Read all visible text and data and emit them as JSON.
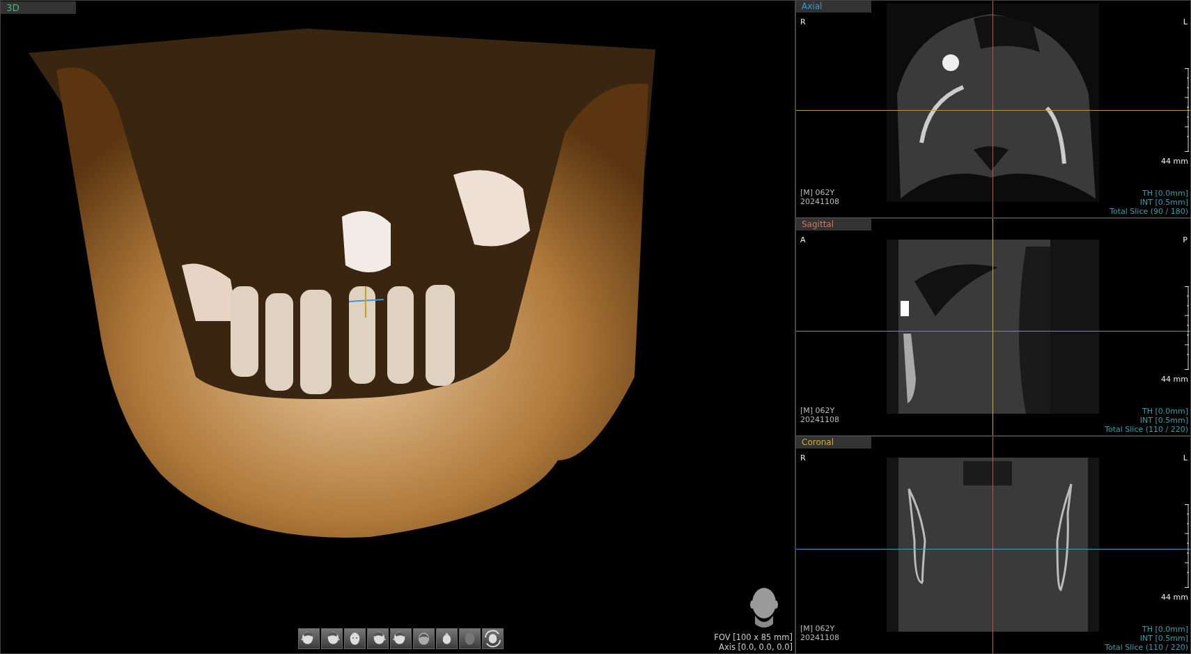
{
  "view_3d": {
    "title": "3D",
    "color": "#3fae7a",
    "fov": "FOV [100 x 85 mm]",
    "axis": "Axis [0.0, 0.0, 0.0]",
    "toolbar": [
      {
        "kind": "left"
      },
      {
        "kind": "right"
      },
      {
        "kind": "front"
      },
      {
        "kind": "right"
      },
      {
        "kind": "left"
      },
      {
        "kind": "back"
      },
      {
        "kind": "top"
      },
      {
        "kind": "blank"
      },
      {
        "kind": "rotate"
      }
    ]
  },
  "slices": [
    {
      "kind": "axial",
      "title": "Axial",
      "color": "#3a9ad9",
      "orient_left": "R",
      "orient_right": "L",
      "scale": "44 mm",
      "patient": "[M] 062Y",
      "date": "20241108",
      "th": "TH [0.0mm]",
      "int": "INT [0.5mm]",
      "total": "Total Slice (90 / 180)",
      "crosshair": [
        {
          "kind": "vertical",
          "color": "#c8505a"
        },
        {
          "kind": "horizontal",
          "color": "#b09a40"
        }
      ]
    },
    {
      "kind": "sagittal",
      "title": "Sagittal",
      "color": "#d9705a",
      "orient_left": "A",
      "orient_right": "P",
      "scale": "44 mm",
      "patient": "[M] 062Y",
      "date": "20241108",
      "th": "TH [0.0mm]",
      "int": "INT [0.5mm]",
      "total": "Total Slice (110 / 220)",
      "crosshair": [
        {
          "kind": "vertical",
          "color": "#c8b030"
        },
        {
          "kind": "horizontal",
          "color": "#4a9ad0"
        }
      ]
    },
    {
      "kind": "coronal",
      "title": "Coronal",
      "color": "#d0b030",
      "orient_left": "R",
      "orient_right": "L",
      "scale": "44 mm",
      "patient": "[M] 062Y",
      "date": "20241108",
      "th": "TH [0.0mm]",
      "int": "INT [0.5mm]",
      "total": "Total Slice (110 / 220)",
      "crosshair": [
        {
          "kind": "vertical",
          "color": "#c8505a"
        },
        {
          "kind": "horizontal",
          "color": "#4a9ad0"
        }
      ]
    }
  ]
}
